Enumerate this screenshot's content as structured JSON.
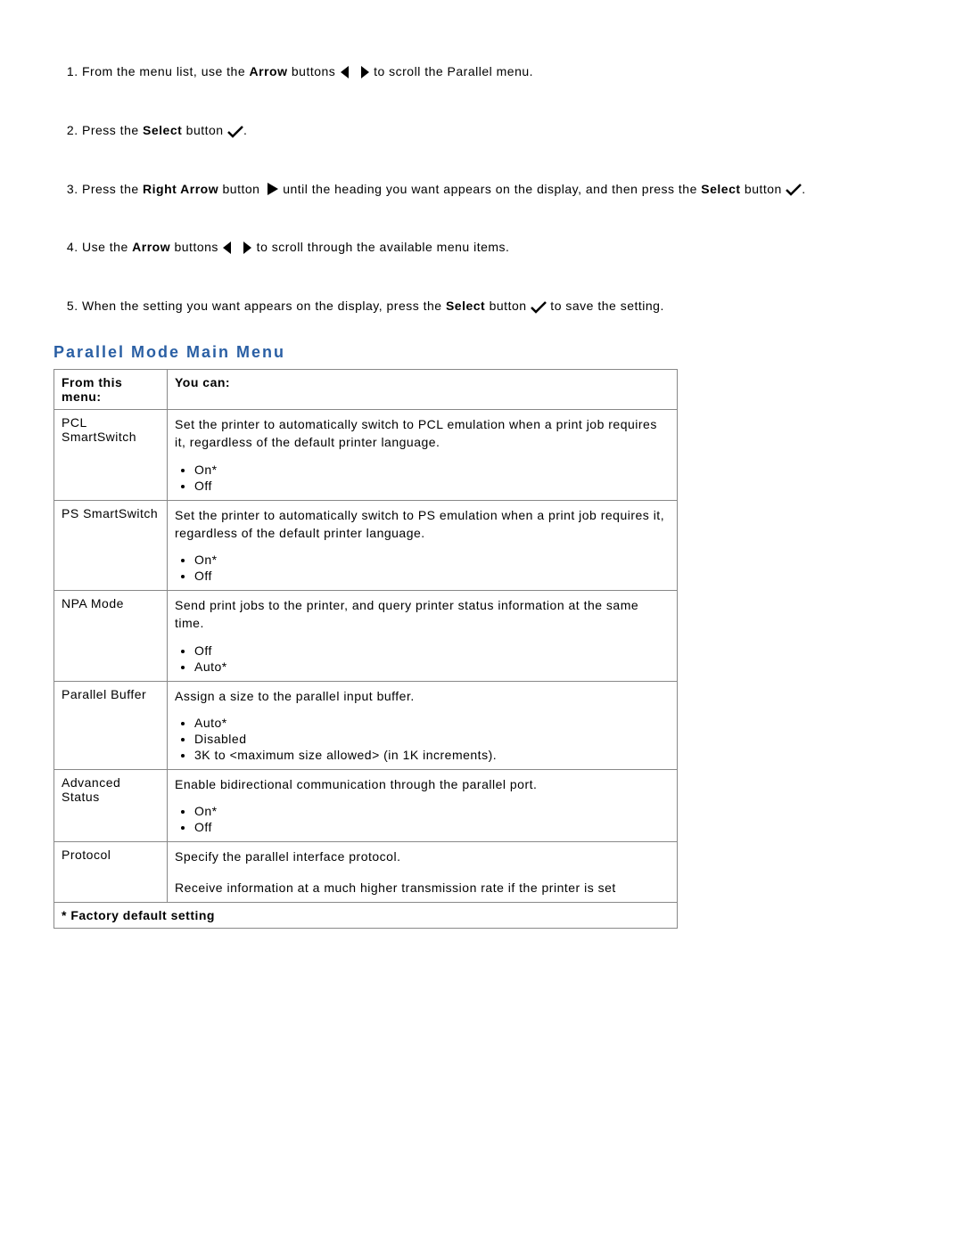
{
  "steps": [
    {
      "pre": "From the menu list, use the ",
      "bold": "Arrow",
      "mid": " buttons ",
      "post": " to scroll the Parallel menu.",
      "icon": "arrows"
    },
    {
      "pre": "Press the ",
      "bold": "Select",
      "mid": " button ",
      "post": ".",
      "icon": "check"
    },
    {
      "pre": "Press the ",
      "bold": "Right Arrow",
      "mid": " button ",
      "post": " until the heading you want appears on the display, and then press the ",
      "bold2": "Select",
      "mid2": " button ",
      "post2": ".",
      "icon": "right",
      "icon2": "check"
    },
    {
      "pre": "Use the ",
      "bold": "Arrow",
      "mid": " buttons ",
      "post": " to scroll through the available menu items.",
      "icon": "arrows"
    },
    {
      "pre": "When the setting you want appears on the display, press the ",
      "bold": "Select",
      "mid": " button ",
      "post": " to save the setting.",
      "icon": "check"
    }
  ],
  "section_title": "Parallel Mode Main Menu",
  "table": {
    "head_a": "From this menu:",
    "head_b": "You can:",
    "rows": [
      {
        "a": "PCL SmartSwitch",
        "b_desc": "Set the printer to automatically switch to PCL emulation when a print job requires it, regardless of the default printer language.",
        "opts": [
          "On*",
          "Off"
        ]
      },
      {
        "a": "PS SmartSwitch",
        "b_desc": "Set the printer to automatically switch to PS emulation when a print job requires it, regardless of the default printer language.",
        "opts": [
          "On*",
          "Off"
        ]
      },
      {
        "a": "NPA Mode",
        "b_desc": "Send print jobs to the printer, and query printer status information at the same time.",
        "opts": [
          "Off",
          "Auto*"
        ]
      },
      {
        "a": "Parallel Buffer",
        "b_desc": "Assign a size to the parallel input buffer.",
        "opts": [
          "Auto*",
          "Disabled",
          "3K to <maximum size allowed> (in 1K increments)."
        ]
      },
      {
        "a": "Advanced Status",
        "b_desc": "Enable bidirectional communication through the parallel port.",
        "opts": [
          "On*",
          "Off"
        ]
      },
      {
        "a": "Protocol",
        "b_desc": "Specify the parallel interface protocol.",
        "b_desc2": "Receive information at a much higher transmission rate if the printer is set",
        "opts": []
      }
    ],
    "footnote": "* Factory default setting"
  }
}
